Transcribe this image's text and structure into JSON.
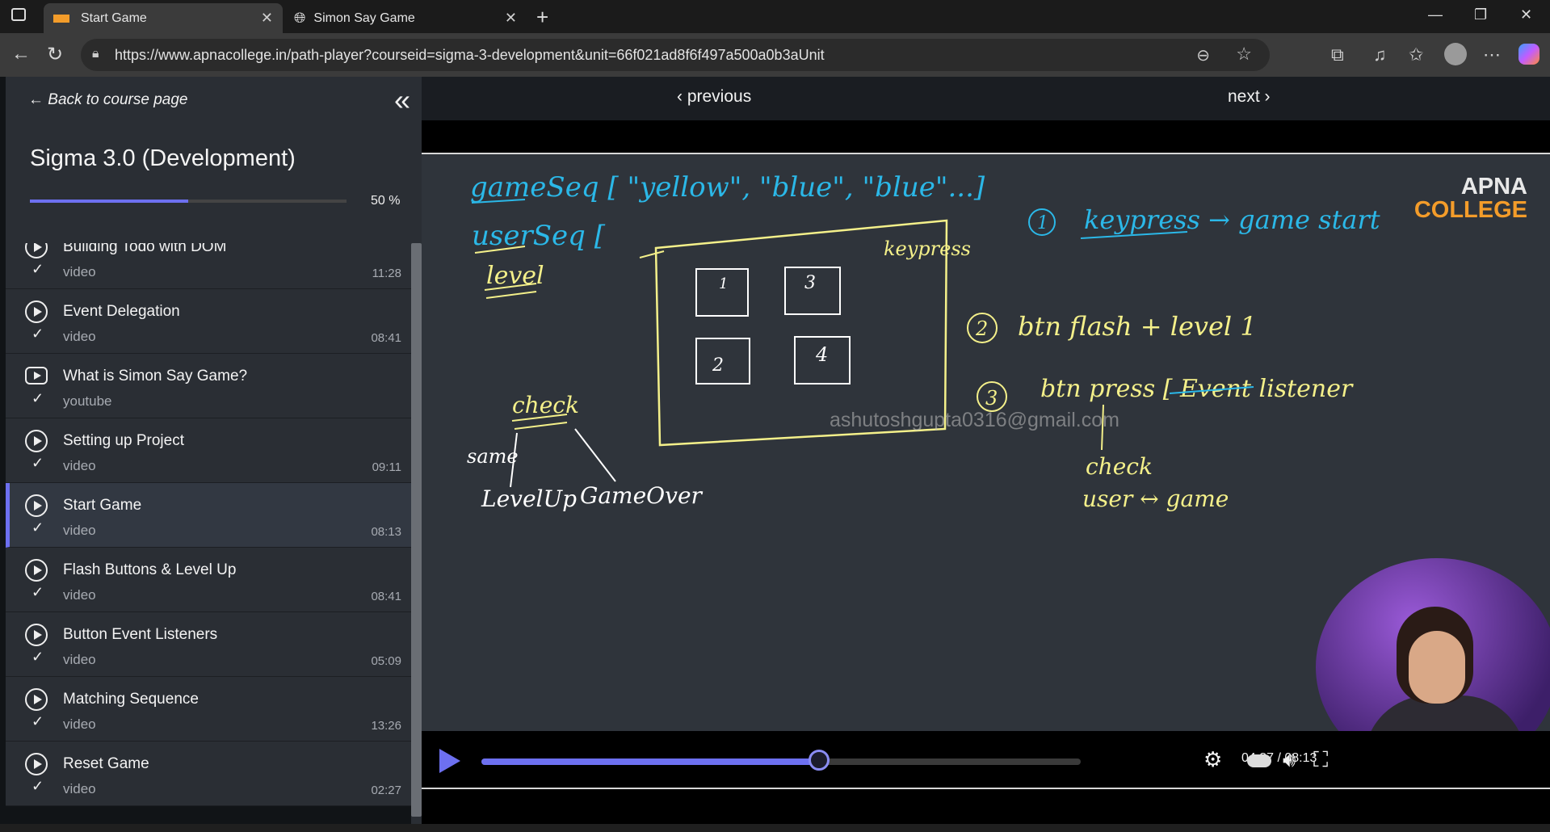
{
  "browser": {
    "tabs": [
      {
        "title": "Start Game",
        "active": true
      },
      {
        "title": "Simon Say Game",
        "active": false
      }
    ],
    "url": "https://www.apnacollege.in/path-player?courseid=sigma-3-development&unit=66f021ad8f6f497a500a0b3aUnit",
    "new_tab_icon": "plus-icon"
  },
  "sidebar": {
    "back_label": "Back to course page",
    "course_title": "Sigma 3.0 (Development)",
    "progress_percent": 50,
    "progress_label": "50 %",
    "lessons": [
      {
        "name": "Building Todo with DOM",
        "type": "video",
        "duration": "11:28",
        "icon": "play-circle-icon"
      },
      {
        "name": "Event Delegation",
        "type": "video",
        "duration": "08:41",
        "icon": "play-circle-icon"
      },
      {
        "name": "What is Simon Say Game?",
        "type": "youtube",
        "duration": "",
        "icon": "youtube-icon"
      },
      {
        "name": "Setting up Project",
        "type": "video",
        "duration": "09:11",
        "icon": "play-circle-icon"
      },
      {
        "name": "Start Game",
        "type": "video",
        "duration": "08:13",
        "icon": "play-circle-icon",
        "current": true
      },
      {
        "name": "Flash Buttons & Level Up",
        "type": "video",
        "duration": "08:41",
        "icon": "play-circle-icon"
      },
      {
        "name": "Button Event Listeners",
        "type": "video",
        "duration": "05:09",
        "icon": "play-circle-icon"
      },
      {
        "name": "Matching Sequence",
        "type": "video",
        "duration": "13:26",
        "icon": "play-circle-icon"
      },
      {
        "name": "Reset Game",
        "type": "video",
        "duration": "02:27",
        "icon": "play-circle-icon"
      }
    ]
  },
  "player": {
    "previous_label": "previous",
    "next_label": "next",
    "time_label": "04:37 / 08:13",
    "played_fraction": 0.563,
    "watermark": "ashutoshgupta0316@gmail.com",
    "logo_line1": "APNA",
    "logo_line2": "COLLEGE",
    "whiteboard": {
      "seq1": "gameSeq [ \"yellow\", \"blue\", \"blue\"...]",
      "seq2": "userSeq [",
      "level": "level",
      "check": "check",
      "same": "same",
      "levelup": "LevelUp",
      "gameover": "GameOver",
      "keypress": "keypress",
      "box1": "1",
      "box2": "2",
      "box3": "3",
      "box4": "4",
      "step1": "keypress → game start",
      "step2": "btn flash + level 1",
      "step3": "btn press [ Event listener",
      "step3_check": "check",
      "step3_cmp": "user ↔ game",
      "n1": "1",
      "n2": "2",
      "n3": "3"
    },
    "colors": {
      "accent": "#6d70f0",
      "cyan_ink": "#2bb8e8",
      "yellow_ink": "#f4f08a",
      "white_ink": "#ffffff"
    }
  }
}
